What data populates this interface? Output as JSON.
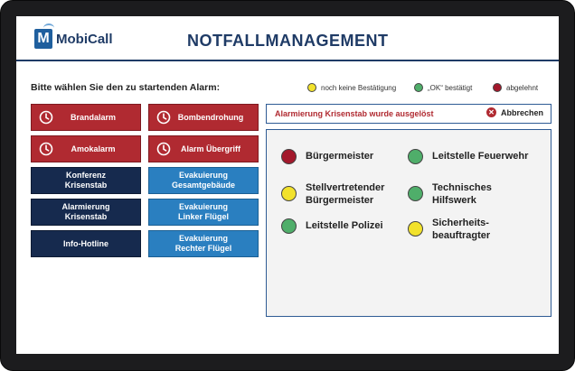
{
  "app": {
    "logo_text": "MobiCall",
    "logo_letter": "M",
    "title": "NOTFALLMANAGEMENT"
  },
  "prompt": "Bitte wählen Sie den zu startenden Alarm:",
  "legend": [
    {
      "label": "noch keine Bestätigung",
      "color": "#f2e22c"
    },
    {
      "label": "„OK“ bestätigt",
      "color": "#4fae6a"
    },
    {
      "label": "abgelehnt",
      "color": "#a3182b"
    }
  ],
  "alarms": [
    {
      "label": "Brandalarm",
      "style": "red"
    },
    {
      "label": "Bombendrohung",
      "style": "red"
    },
    {
      "label": "Amokalarm",
      "style": "red"
    },
    {
      "label": "Alarm Übergriff",
      "style": "red"
    },
    {
      "label": "Konferenz\nKrisenstab",
      "style": "navy"
    },
    {
      "label": "Evakuierung\nGesamtgebäude",
      "style": "blue"
    },
    {
      "label": "Alarmierung\nKrisenstab",
      "style": "navy"
    },
    {
      "label": "Evakuierung\nLinker Flügel",
      "style": "blue"
    },
    {
      "label": "Info-Hotline",
      "style": "navy"
    },
    {
      "label": "Evakuierung\nRechter Flügel",
      "style": "blue"
    }
  ],
  "status": {
    "message": "Alarmierung Krisenstab wurde ausgelöst",
    "abort_label": "Abbrechen"
  },
  "members": [
    {
      "name": "Bürgermeister",
      "status_color": "#a3182b"
    },
    {
      "name": "Leitstelle Feuerwehr",
      "status_color": "#4fae6a"
    },
    {
      "name": "Stellvertretender\nBürgermeister",
      "status_color": "#f2e22c"
    },
    {
      "name": "Technisches\nHilfswerk",
      "status_color": "#4fae6a"
    },
    {
      "name": "Leitstelle Polizei",
      "status_color": "#4fae6a"
    },
    {
      "name": "Sicherheits-\nbeauftragter",
      "status_color": "#f2e22c"
    }
  ]
}
